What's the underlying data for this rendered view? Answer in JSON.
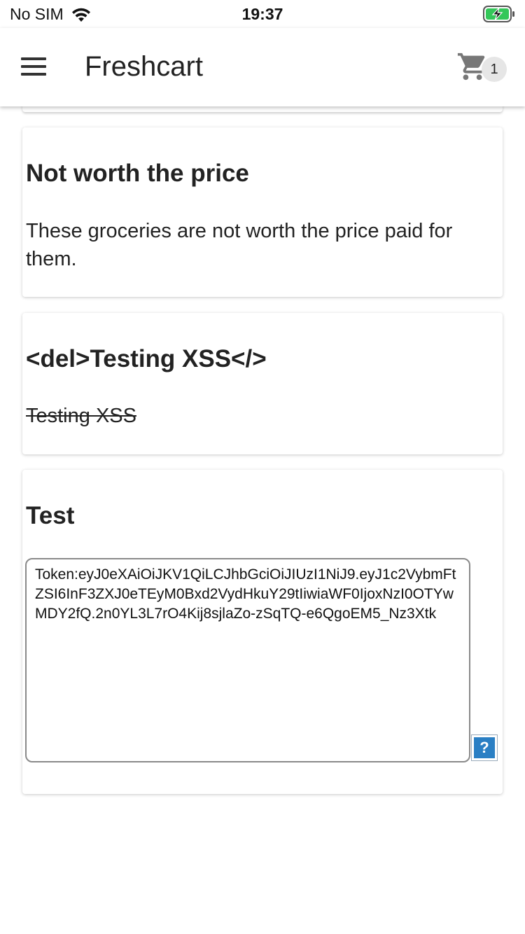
{
  "status": {
    "carrier": "No SIM",
    "time": "19:37"
  },
  "header": {
    "title": "Freshcart",
    "cart_count": "1"
  },
  "reviews": [
    {
      "title": "Not worth the price",
      "body": "These groceries are not worth the price paid for them."
    },
    {
      "title": "<del>Testing XSS</>",
      "body": "Testing XSS"
    },
    {
      "title": "Test",
      "body": "Token:eyJ0eXAiOiJKV1QiLCJhbGciOiJIUzI1NiJ9.eyJ1c2VybmFtZSI6InF3ZXJ0eTEyM0Bxd2VydHkuY29tIiwiaWF0IjoxNzI0OTYwMDY2fQ.2n0YL3L7rO4Kij8sjlaZo-zSqTQ-e6QgoEM5_Nz3Xtk",
      "help_label": "?"
    }
  ],
  "colors": {
    "help_blue": "#2a7fc4",
    "battery_green": "#34c759"
  }
}
